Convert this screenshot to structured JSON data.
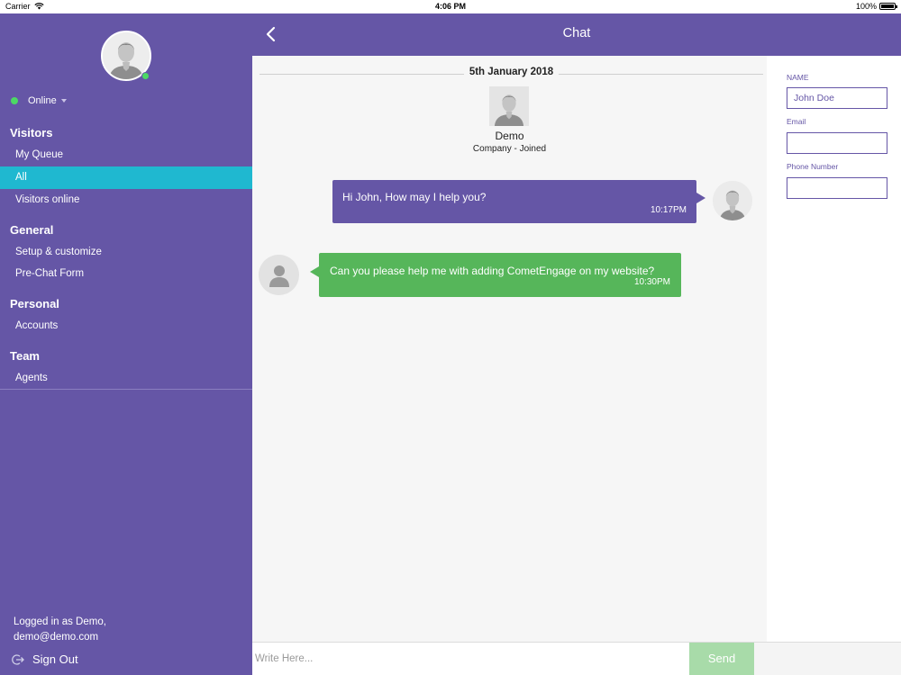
{
  "status_bar": {
    "carrier": "Carrier",
    "time": "4:06 PM",
    "battery": "100%"
  },
  "sidebar": {
    "status": "Online",
    "sections": [
      {
        "title": "Visitors",
        "items": [
          "My Queue",
          "All",
          "Visitors online"
        ]
      },
      {
        "title": "General",
        "items": [
          "Setup & customize",
          "Pre-Chat Form"
        ]
      },
      {
        "title": "Personal",
        "items": [
          "Accounts"
        ]
      },
      {
        "title": "Team",
        "items": [
          "Agents"
        ]
      }
    ],
    "active_item": "All",
    "logged_in_line1": "Logged in as Demo,",
    "logged_in_line2": "demo@demo.com",
    "sign_out": "Sign Out"
  },
  "header": {
    "title": "Chat"
  },
  "chat": {
    "date": "5th January 2018",
    "joined_name": "Demo",
    "joined_sub": "Company - Joined",
    "messages": [
      {
        "direction": "out",
        "text": "Hi John, How may I help you?",
        "time": "10:17PM"
      },
      {
        "direction": "in",
        "text": "Can you please help me with adding CometEngage on my website?",
        "time": "10:30PM"
      }
    ]
  },
  "visitor_info": {
    "name_label": "NAME",
    "name_value": "John Doe",
    "email_label": "Email",
    "email_value": "",
    "phone_label": "Phone Number",
    "phone_value": ""
  },
  "compose": {
    "placeholder": "Write Here...",
    "send_label": "Send"
  },
  "colors": {
    "primary": "#6556a6",
    "active_item": "#1fb8d0",
    "online": "#4cd964",
    "incoming_bubble": "#56b65a",
    "send_disabled": "#a8dba9"
  }
}
